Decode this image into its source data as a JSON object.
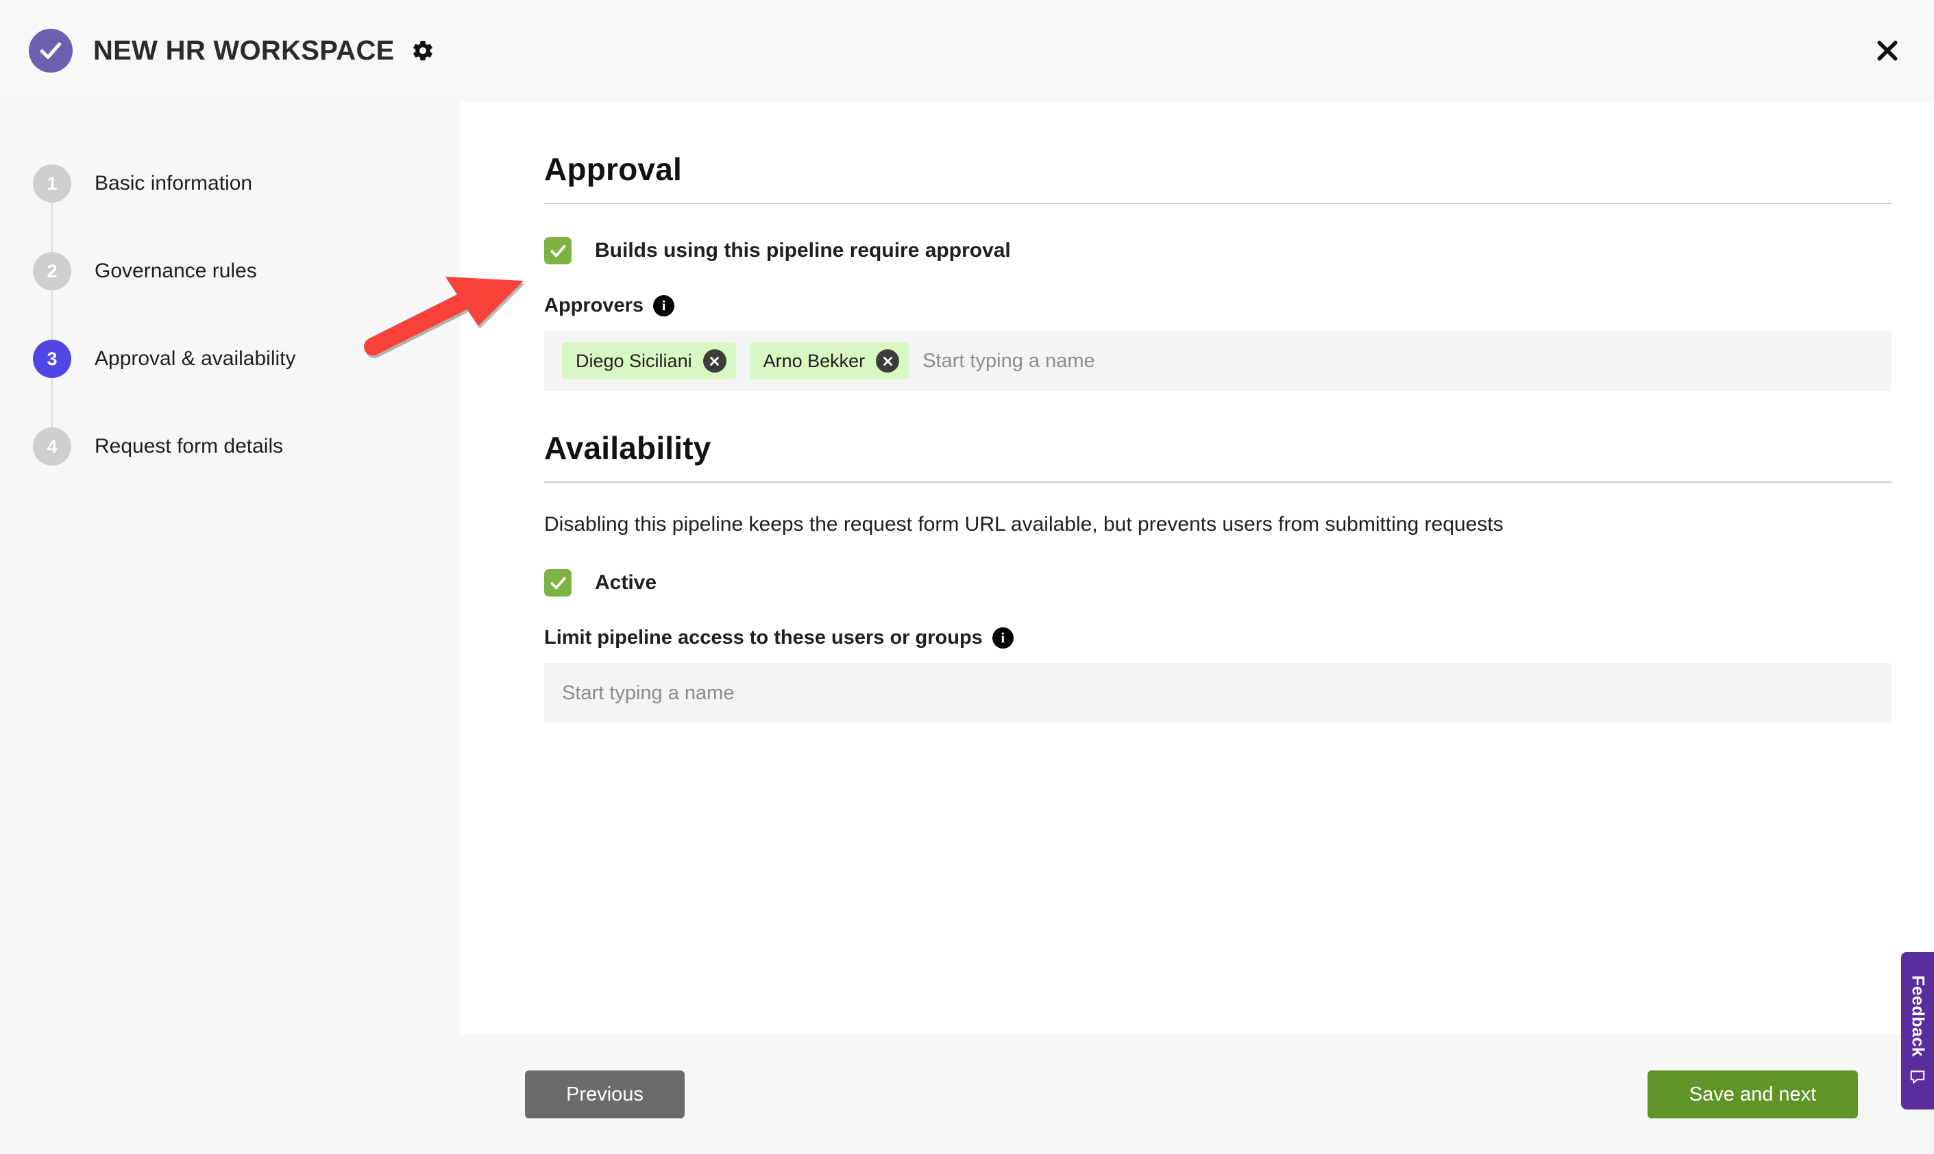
{
  "header": {
    "title": "NEW HR WORKSPACE",
    "brand_icon": "check-circle-icon",
    "settings_icon": "gear-icon",
    "close_icon": "close-icon"
  },
  "sidebar": {
    "steps": [
      {
        "number": "1",
        "label": "Basic information",
        "active": false
      },
      {
        "number": "2",
        "label": "Governance rules",
        "active": false
      },
      {
        "number": "3",
        "label": "Approval & availability",
        "active": true
      },
      {
        "number": "4",
        "label": "Request form details",
        "active": false
      }
    ]
  },
  "approval": {
    "heading": "Approval",
    "require_approval_label": "Builds using this pipeline require approval",
    "require_approval_checked": true,
    "approvers_label": "Approvers",
    "approvers_info_icon": "info-icon",
    "approvers": [
      {
        "name": "Diego Siciliani",
        "remove_icon": "close-icon"
      },
      {
        "name": "Arno Bekker",
        "remove_icon": "close-icon"
      }
    ],
    "approvers_placeholder": "Start typing a name"
  },
  "availability": {
    "heading": "Availability",
    "description": "Disabling this pipeline keeps the request form URL available, but prevents users from submitting requests",
    "active_label": "Active",
    "active_checked": true,
    "limit_access_label": "Limit pipeline access to these users or groups",
    "limit_access_info_icon": "info-icon",
    "limit_access_placeholder": "Start typing a name"
  },
  "footer": {
    "previous_label": "Previous",
    "save_next_label": "Save and next"
  },
  "feedback": {
    "label": "Feedback",
    "icon": "comment-icon"
  },
  "colors": {
    "brand_purple": "#6b5faf",
    "active_step_indigo": "#5046e5",
    "checkbox_green": "#7cb342",
    "token_green": "#d8f7c2",
    "save_button_green": "#5f9427",
    "previous_button_gray": "#6b6b6b",
    "feedback_purple": "#5a2d9e",
    "annotation_red": "#f9423a"
  }
}
